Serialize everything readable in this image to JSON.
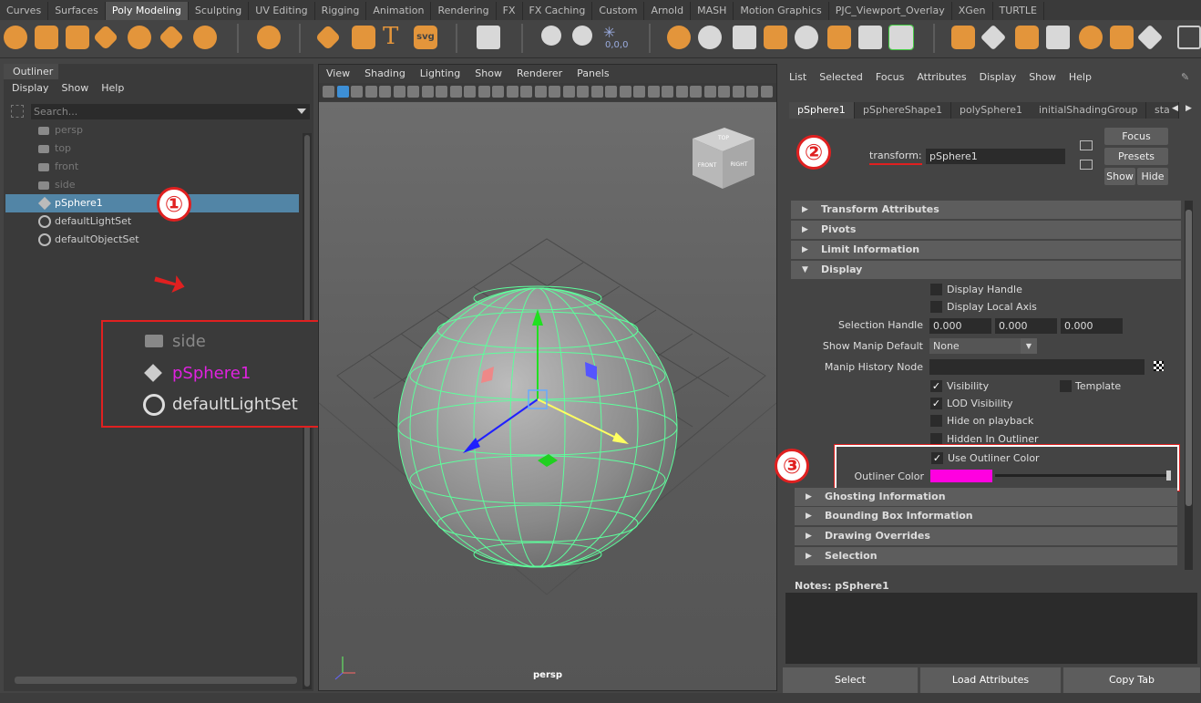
{
  "shelf_tabs": [
    "Curves",
    "Surfaces",
    "Poly Modeling",
    "Sculpting",
    "UV Editing",
    "Rigging",
    "Animation",
    "Rendering",
    "FX",
    "FX Caching",
    "Custom",
    "Arnold",
    "MASH",
    "Motion Graphics",
    "PJC_Viewport_Overlay",
    "XGen",
    "TURTLE"
  ],
  "shelf": {
    "svg_label": "svg",
    "text_tool_label": "T",
    "coords_label": "0,0,0"
  },
  "outliner": {
    "tab": "Outliner",
    "menu": [
      "Display",
      "Show",
      "Help"
    ],
    "search_placeholder": "Search...",
    "items": [
      "persp",
      "top",
      "front",
      "side",
      "pSphere1",
      "defaultLightSet",
      "defaultObjectSet"
    ]
  },
  "callout": {
    "items": [
      "side",
      "pSphere1",
      "defaultLightSet"
    ],
    "outliner_color": "#e022e0"
  },
  "badges": [
    "①",
    "②",
    "③"
  ],
  "viewport": {
    "menu": [
      "View",
      "Shading",
      "Lighting",
      "Show",
      "Renderer",
      "Panels"
    ],
    "camera_label": "persp",
    "cube_labels": [
      "TOP",
      "FRONT",
      "RIGHT"
    ]
  },
  "attribute_editor": {
    "menu": [
      "List",
      "Selected",
      "Focus",
      "Attributes",
      "Display",
      "Show",
      "Help"
    ],
    "node_tabs": [
      "pSphere1",
      "pSphereShape1",
      "polySphere1",
      "initialShadingGroup",
      "sta"
    ],
    "transform_label": "transform:",
    "transform_value": "pSphere1",
    "buttons": {
      "focus": "Focus",
      "presets": "Presets",
      "show": "Show",
      "hide": "Hide"
    },
    "sections": [
      "Transform Attributes",
      "Pivots",
      "Limit Information",
      "Display"
    ],
    "display": {
      "display_handle": "Display Handle",
      "display_local_axis": "Display Local Axis",
      "selection_handle_label": "Selection Handle",
      "selection_handle": [
        "0.000",
        "0.000",
        "0.000"
      ],
      "show_manip_label": "Show Manip Default",
      "show_manip_value": "None",
      "manip_history_label": "Manip History Node",
      "visibility": "Visibility",
      "template": "Template",
      "lod_visibility": "LOD Visibility",
      "hide_on_playback": "Hide on playback",
      "hidden_in_outliner": "Hidden In Outliner",
      "use_outliner_color": "Use Outliner Color",
      "outliner_color_label": "Outliner Color",
      "outliner_color": "#ff00e0"
    },
    "lower_sections": [
      "Ghosting Information",
      "Bounding Box Information",
      "Drawing Overrides",
      "Selection"
    ],
    "notes_label": "Notes:  pSphere1",
    "bottom_buttons": [
      "Select",
      "Load Attributes",
      "Copy Tab"
    ]
  }
}
